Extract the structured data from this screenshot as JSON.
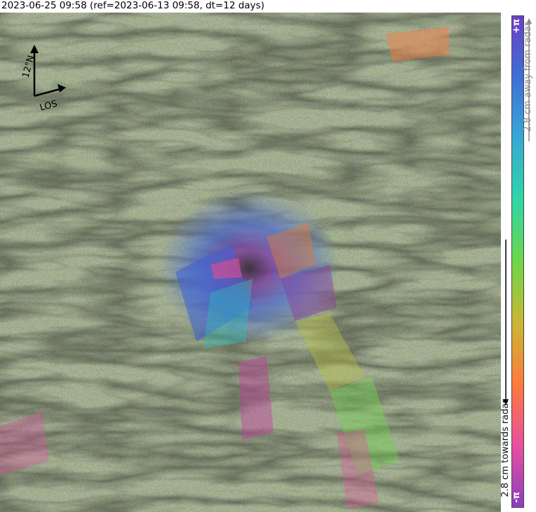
{
  "title": "2023-06-25 09:58 (ref=2023-06-13 09:58, dt=12 days)",
  "map": {
    "north_label": "12°N",
    "los_label": "LOS"
  },
  "colorbar": {
    "top_label": "+π",
    "bottom_label": "-π",
    "away_text": "2.8 cm away from radar",
    "towards_text": "2.8 cm towards radar",
    "colors": [
      "#8a3fbf",
      "#e94fa0",
      "#ff7a3d",
      "#c9b733",
      "#6ed64a",
      "#2fd6a6",
      "#38a9d6",
      "#3f6fd6",
      "#6a3fc8"
    ]
  }
}
